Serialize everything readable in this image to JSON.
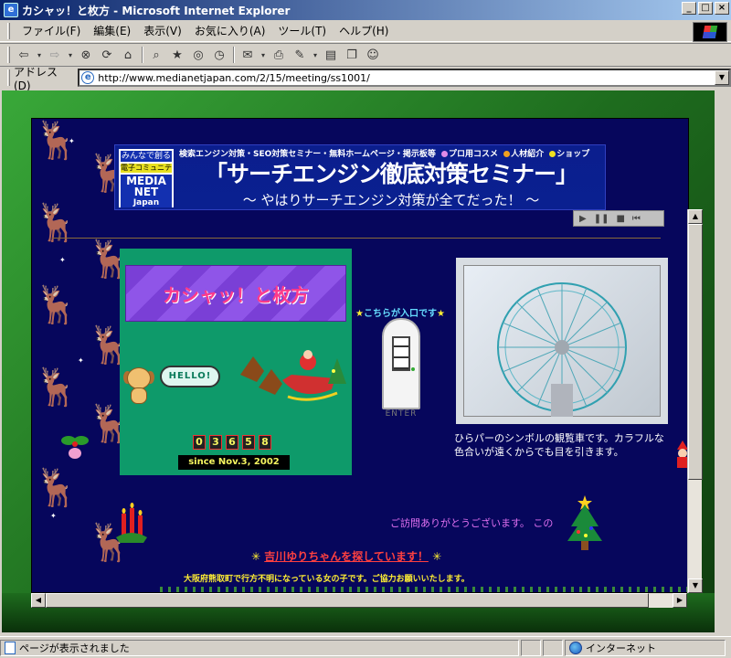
{
  "window": {
    "title": "カシャッ！と枚方 - Microsoft Internet Explorer",
    "controls": {
      "minimize": "_",
      "maximize": "□",
      "close": "×"
    }
  },
  "menu": [
    "ファイル(F)",
    "編集(E)",
    "表示(V)",
    "お気に入り(A)",
    "ツール(T)",
    "ヘルプ(H)"
  ],
  "toolbar": {
    "icons": [
      "back-icon",
      "forward-icon",
      "stop-icon",
      "refresh-icon",
      "home-icon",
      "search-icon",
      "favorites-icon",
      "history-icon",
      "mail-icon",
      "print-icon",
      "edit-icon",
      "discuss-icon",
      "messenger-icon"
    ]
  },
  "address": {
    "label": "アドレス(D)",
    "url": "http://www.medianetjapan.com/2/15/meeting/ss1001/"
  },
  "banner": {
    "logo_line1": "みんなで創る",
    "logo_line2": "電子コミュニティ",
    "logo_line3": "MEDIA",
    "logo_line4": "NET",
    "logo_line5": "Japan",
    "nav_text": "検索エンジン対策・SEO対策セミナー・無料ホームページ・掲示板等",
    "nav_cosme": "プロ用コスメ",
    "nav_jobs": "人材紹介",
    "nav_shop": "ショップ",
    "title": "「サーチエンジン徹底対策セミナー」",
    "subtitle": "～ やはりサーチエンジン対策が全てだった！ ～"
  },
  "site": {
    "title": "カシャッ！と枚方",
    "hello": "HELLO!",
    "counter": [
      "0",
      "3",
      "6",
      "5",
      "8"
    ],
    "since": "since Nov.3, 2002",
    "entrance": "こちらが入口です",
    "enter": "ENTER",
    "caption": "ひらパーのシンボルの観覧車です。カラフルな色合いが遠くからでも目を引きます。",
    "thanks": "ご訪問ありがとうございます。 この",
    "missing_title": "吉川ゆりちゃんを探しています！",
    "missing_desc": "大阪府熊取町で行方不明になっている女の子です。ご協力お願いいたします。"
  },
  "status": {
    "message": "ページが表示されました",
    "zone": "インターネット"
  },
  "colors": {
    "page_bg": "#06065c",
    "frame": "#1e6c1e",
    "titlebar": "#0a246a"
  }
}
